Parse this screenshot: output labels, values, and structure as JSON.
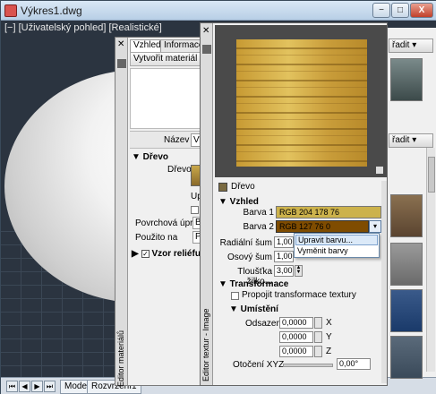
{
  "window": {
    "title": "Výkres1.dwg",
    "viewport_label": "[−] [Uživatelský pohled] [Realistické]",
    "min_label": "−",
    "max_label": "□",
    "close_label": "X"
  },
  "bottom_bar": {
    "nav_first": "⏮",
    "nav_prev": "◀",
    "nav_next": "▶",
    "nav_last": "⏭",
    "tab_model": "Model",
    "tab_layout": "Rozvržení1"
  },
  "browser": {
    "sort_1": "řadit ▾",
    "sort_2": "řadit ▾"
  },
  "material_editor": {
    "vertical_title": "Editor materiálů",
    "tab_vzhled": "Vzhled",
    "tab_info": "Informace",
    "create_label": "Vytvořit materiál ▾",
    "name_label": "Název",
    "name_value": "Vý",
    "section_wood": "▼ Dřevo",
    "wood_label": "Dřevo",
    "up_label": "Up",
    "surface_label": "Povrchová úpr...",
    "surface_value": "Be",
    "use_label": "Použito na",
    "use_value": "Po",
    "relief_label": "Vzor reliéfu",
    "relief_check": "✓"
  },
  "texture_editor": {
    "vertical_title": "Editor textur - Image",
    "name": "Dřevo",
    "section_vzhled": "▼ Vzhled",
    "color1_label": "Barva 1",
    "color1_value": "RGB 204 178 76",
    "color2_label": "Barva 2",
    "color2_value": "RGB 127 76 0",
    "radial_label": "Radiální šum",
    "radial_value": "1,00",
    "axial_label": "Osový šum",
    "axial_value": "1,00",
    "thickness_label": "Tloušťka žilko...",
    "thickness_value": "3,00",
    "section_transform": "▼ Transformace",
    "link_label": "Propojit transformace textury",
    "section_placement": "▼ Umístění",
    "offset_label": "Odsazení",
    "offset_x": "0,0000",
    "offset_y": "0,0000",
    "offset_z": "0,0000",
    "axis_x": "X",
    "axis_y": "Y",
    "axis_z": "Z",
    "rotation_label": "Otočení XYZ",
    "rotation_value": "0,00°"
  },
  "color_menu": {
    "edit": "Upravit barvu...",
    "swap": "Vyměnit barvy"
  },
  "colors": {
    "color1": "#ccb24c",
    "color2": "#7f4c00"
  }
}
